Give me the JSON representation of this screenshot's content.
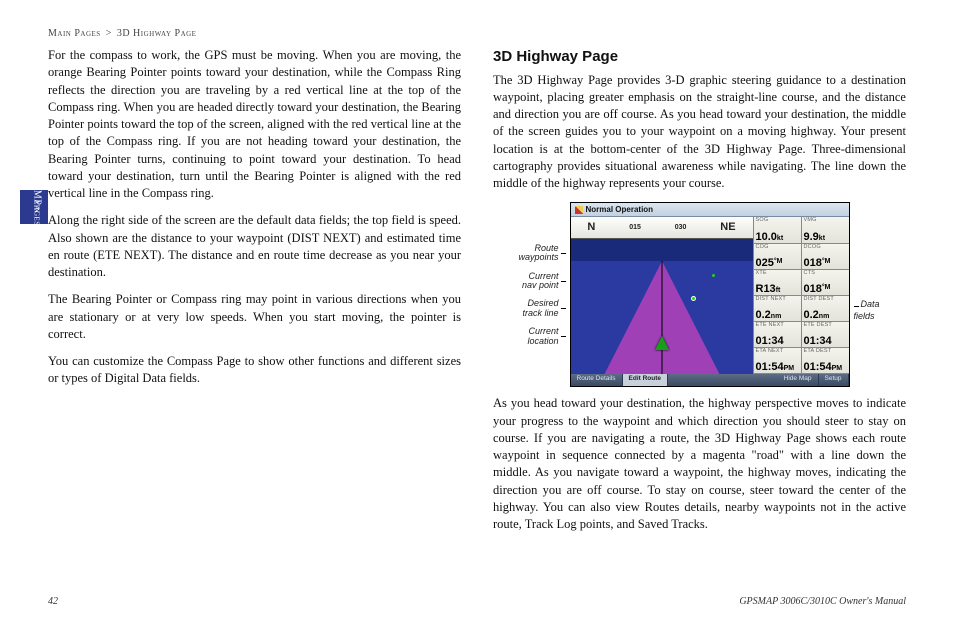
{
  "breadcrumb": {
    "section": "Main Pages",
    "sep": ">",
    "page": "3D Highway Page"
  },
  "side_tab": {
    "line1": "Main",
    "line2": "Pages"
  },
  "left": {
    "p1": "For the compass to work, the GPS must be moving. When you are moving, the orange Bearing Pointer points toward your destination, while the Compass Ring reflects the direction you are traveling by a red vertical line at the top of the Compass ring. When you are headed directly toward your destination, the Bearing Pointer points toward the top of the screen, aligned with the red vertical line at the top of the Compass ring. If you are not heading toward your destination, the Bearing Pointer turns, continuing to point toward your destination. To head toward your destination, turn until the Bearing Pointer is aligned with the red vertical line in the Compass ring.",
    "p2": "Along the right side of the screen are the default data fields; the top field is speed. Also shown are the distance to your waypoint (DIST NEXT) and estimated time en route (ETE NEXT). The distance and en route time decrease as you near your destination.",
    "p3": "The Bearing Pointer or Compass ring may point in various directions when you are stationary or at very low speeds. When you start moving, the pointer is correct.",
    "p4": "You can customize the Compass Page to show other functions and different sizes or types of Digital Data fields."
  },
  "right": {
    "title": "3D Highway Page",
    "p1": "The 3D Highway Page provides 3-D graphic steering guidance to a destination waypoint, placing greater emphasis on the straight-line course, and the distance and direction you are off course. As you head toward your destination, the middle of the screen guides you to your waypoint on a moving highway. Your present location is at the bottom-center of the 3D Highway Page. Three-dimensional cartography provides situational awareness while navigating. The line down the middle of the highway represents your course.",
    "p2": "As you head toward your destination, the highway perspective moves to indicate your progress to the waypoint and which direction you should steer to stay on course. If you are navigating a route, the 3D Highway Page shows each route waypoint in sequence connected by a magenta \"road\" with a line down the middle. As you navigate toward a waypoint, the highway moves, indicating the direction you are off course. To stay on course, steer toward the center of the highway. You can also view Routes details, nearby waypoints not in the active route, Track Log points, and Saved Tracks."
  },
  "figure": {
    "title": "Normal Operation",
    "compass": {
      "dir1": "N",
      "t1": "015",
      "t2": "030",
      "dir2": "NE"
    },
    "labels_left": {
      "l1": "Route waypoints",
      "l2": "Current nav point",
      "l3": "Desired track line",
      "l4": "Current location"
    },
    "labels_right": {
      "r1": "Data fields"
    },
    "data": {
      "sog": {
        "lbl": "SOG",
        "val": "10.0",
        "unit": "kt"
      },
      "vmg": {
        "lbl": "VMG",
        "val": "9.9",
        "unit": "kt"
      },
      "cog": {
        "lbl": "COG",
        "val": "025",
        "unit": "°M"
      },
      "dcog": {
        "lbl": "DCOG",
        "val": "018",
        "unit": "°M"
      },
      "xte": {
        "lbl": "XTE",
        "val": "R13",
        "unit": "ft"
      },
      "cts": {
        "lbl": "CTS",
        "val": "018",
        "unit": "°M"
      },
      "distn": {
        "lbl": "DIST NEXT",
        "val": "0.2",
        "unit": "nm"
      },
      "distd": {
        "lbl": "DIST DEST",
        "val": "0.2",
        "unit": "nm"
      },
      "eten": {
        "lbl": "ETE NEXT",
        "val": "01:34",
        "unit": ""
      },
      "eted": {
        "lbl": "ETE DEST",
        "val": "01:34",
        "unit": ""
      },
      "etan": {
        "lbl": "ETA NEXT",
        "val": "01:54",
        "unit": "PM"
      },
      "etad": {
        "lbl": "ETA DEST",
        "val": "01:54",
        "unit": "PM"
      }
    },
    "footer": {
      "t1": "Route Details",
      "t2": "Edit Route",
      "t3": "Hide Map",
      "t4": "Setup"
    }
  },
  "footer": {
    "page_no": "42",
    "manual": "GPSMAP 3006C/3010C Owner's Manual"
  },
  "chart_data": {
    "type": "table",
    "title": "3D Highway Page data fields",
    "series": [
      {
        "name": "SOG",
        "values": [
          "10.0 kt"
        ]
      },
      {
        "name": "VMG",
        "values": [
          "9.9 kt"
        ]
      },
      {
        "name": "COG",
        "values": [
          "025°M"
        ]
      },
      {
        "name": "DCOG",
        "values": [
          "018°M"
        ]
      },
      {
        "name": "XTE",
        "values": [
          "R13 ft"
        ]
      },
      {
        "name": "CTS",
        "values": [
          "018°M"
        ]
      },
      {
        "name": "DIST NEXT",
        "values": [
          "0.2 nm"
        ]
      },
      {
        "name": "DIST DEST",
        "values": [
          "0.2 nm"
        ]
      },
      {
        "name": "ETE NEXT",
        "values": [
          "01:34"
        ]
      },
      {
        "name": "ETE DEST",
        "values": [
          "01:34"
        ]
      },
      {
        "name": "ETA NEXT",
        "values": [
          "01:54 PM"
        ]
      },
      {
        "name": "ETA DEST",
        "values": [
          "01:54 PM"
        ]
      }
    ],
    "compass_strip": [
      "N",
      "015",
      "030",
      "NE"
    ]
  }
}
